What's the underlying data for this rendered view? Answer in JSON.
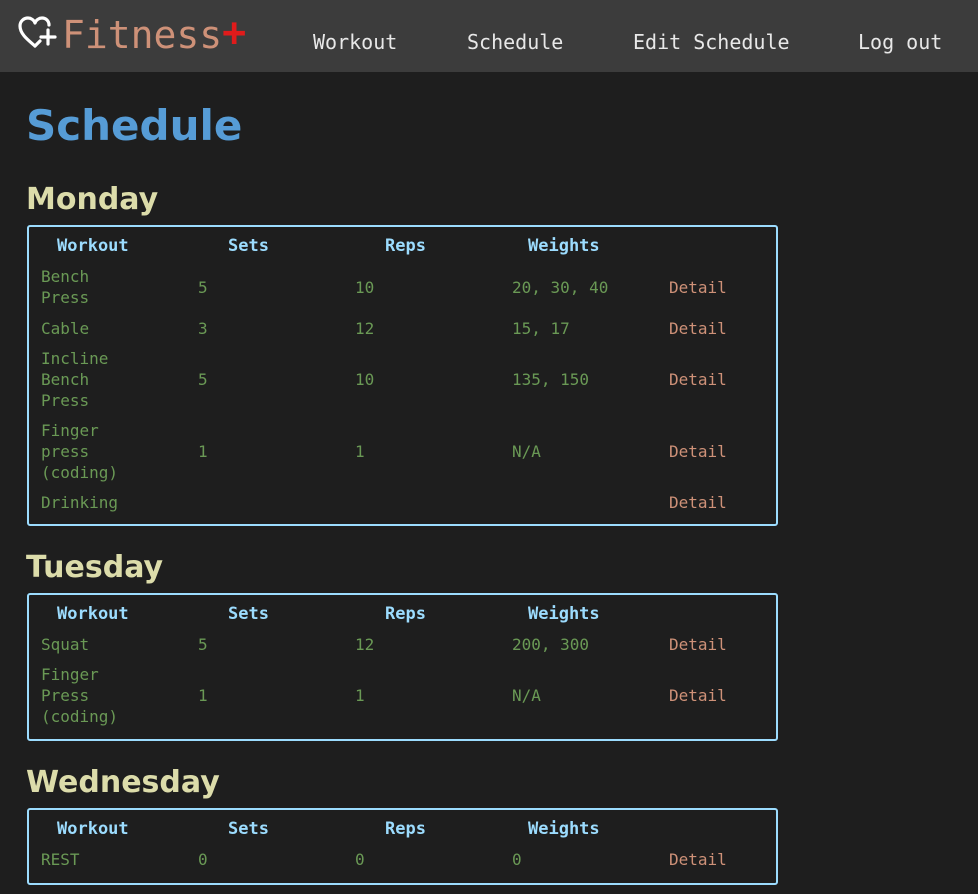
{
  "brand": {
    "name": "Fitness",
    "plus": "+",
    "icon": "heart-plus-icon",
    "color": "#ce9178",
    "plus_color": "#e01b1b"
  },
  "nav": [
    {
      "label": "Workout"
    },
    {
      "label": "Schedule"
    },
    {
      "label": "Edit Schedule"
    },
    {
      "label": "Log out"
    }
  ],
  "page_title": "Schedule",
  "columns": {
    "workout": "Workout",
    "sets": "Sets",
    "reps": "Reps",
    "weights": "Weights"
  },
  "detail_label": "Detail",
  "days": [
    {
      "name": "Monday",
      "rows": [
        {
          "workout": "Bench\nPress",
          "sets": "5",
          "reps": "10",
          "weights": "20, 30, 40"
        },
        {
          "workout": "Cable",
          "sets": "3",
          "reps": "12",
          "weights": "15, 17"
        },
        {
          "workout": "Incline\nBench\nPress",
          "sets": "5",
          "reps": "10",
          "weights": "135, 150"
        },
        {
          "workout": "Finger\npress\n(coding)",
          "sets": "1",
          "reps": "1",
          "weights": "N/A"
        },
        {
          "workout": "Drinking",
          "sets": "",
          "reps": "",
          "weights": ""
        }
      ]
    },
    {
      "name": "Tuesday",
      "rows": [
        {
          "workout": "Squat",
          "sets": "5",
          "reps": "12",
          "weights": "200, 300"
        },
        {
          "workout": "Finger\nPress\n(coding)",
          "sets": "1",
          "reps": "1",
          "weights": "N/A"
        }
      ]
    },
    {
      "name": "Wednesday",
      "rows": [
        {
          "workout": "REST",
          "sets": "0",
          "reps": "0",
          "weights": "0"
        }
      ]
    }
  ]
}
